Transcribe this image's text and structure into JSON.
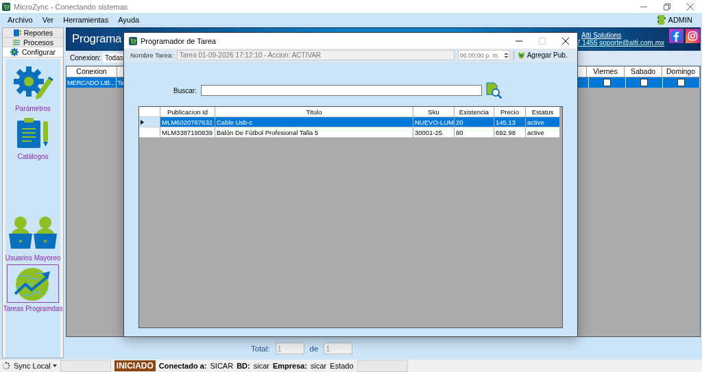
{
  "window": {
    "title": "MicroZync - Conectando sistemas"
  },
  "menu": [
    {
      "label": "Archivo"
    },
    {
      "label": "Ver"
    },
    {
      "label": "Herramientas"
    },
    {
      "label": "Ayuda"
    }
  ],
  "user": {
    "name": "ADMIN"
  },
  "nav_tabs": [
    {
      "label": "Reportes",
      "kind": "report",
      "selected": false
    },
    {
      "label": "Procesos",
      "kind": "process",
      "selected": false
    },
    {
      "label": "Configurar",
      "kind": "config",
      "selected": true
    }
  ],
  "nav_items": [
    {
      "label": "Parámetros",
      "kind": "gear",
      "selected": false
    },
    {
      "label": "Catálogos",
      "kind": "clipboard",
      "selected": false
    },
    {
      "label": "Usuarios Mayoreo",
      "kind": "users",
      "selected": false
    },
    {
      "label": "Tareas Programdas",
      "kind": "globe",
      "selected": true
    }
  ],
  "header": {
    "title": "Programa",
    "company_link": "Atti Solutions",
    "contact": "7 1455  soporte@atti.com.mx"
  },
  "filter": {
    "label": "Conexion:",
    "value": "Todas"
  },
  "main_table": {
    "columns": [
      "Conexion",
      "Viernes",
      "Sabado",
      "Domingo"
    ],
    "rows": [
      {
        "conexion": "MERCADO LIB...",
        "column_2": "Ta",
        "days": [
          false,
          false,
          false
        ],
        "selected": true
      }
    ]
  },
  "pager": {
    "label": "Total:",
    "value": "1",
    "separator": "de",
    "total": "1"
  },
  "dialog": {
    "title": "Programador de Tarea",
    "name_label": "Nombre Tarea:",
    "name_value": "Tarea 01-09-2026 17:12:10 - Accion: ACTIVAR",
    "time": "06:00:00 p. m.",
    "add_button": "Agregar Pub.",
    "search_label": "Buscar:",
    "table": {
      "columns": [
        "Publicacion Id",
        "Titulo",
        "Sku",
        "Existencia",
        "Precio",
        "Estatus"
      ],
      "rows": [
        {
          "cells": [
            "MLM6020767632",
            "Cable Usb-c",
            "NUEVO-LUM",
            "20",
            "145.13",
            "active"
          ],
          "selected": true
        },
        {
          "cells": [
            "MLM3387190839",
            "Balón De Fútbol Profesional Talla 5",
            "30001-25",
            "80",
            "692.98",
            "active"
          ],
          "selected": false
        }
      ]
    }
  },
  "status_bar": {
    "sync": "Sync Local",
    "state": "INICIADO",
    "connected_label": "Conectado a:",
    "connected": "SICAR",
    "db_label": "BD:",
    "db": "sicar",
    "company_label": "Empresa:",
    "company": "sicar",
    "estado_label": "Estado"
  }
}
